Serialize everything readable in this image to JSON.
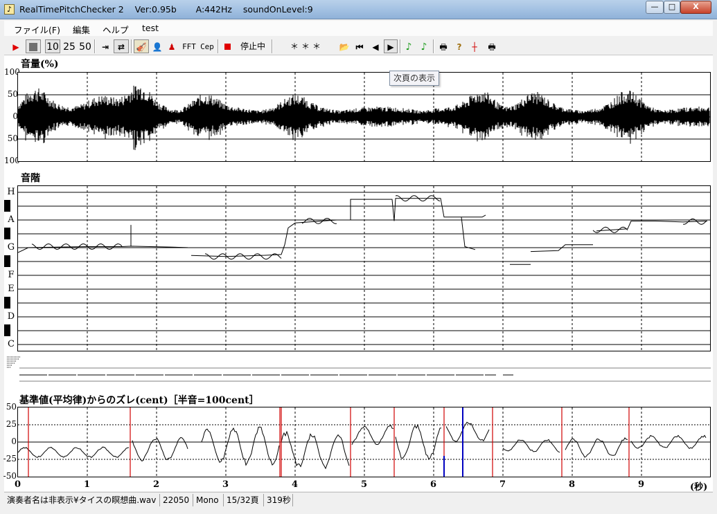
{
  "window": {
    "title": "RealTimePitchChecker 2    Ver:0.95b       A:442Hz    soundOnLevel:9",
    "minimize": "—",
    "maximize": "□",
    "close": "X"
  },
  "menu": [
    "ファイル(F)",
    "編集",
    "ヘルプ",
    "test"
  ],
  "toolbar": {
    "speed_10": "10",
    "speed_25": "25",
    "speed_50": "50",
    "fft": "FFT",
    "cep": "Cep",
    "status": "停止中",
    "stars": "＊＊＊",
    "colors": {
      "play": "#e00000",
      "stop_red": "#e00000",
      "note_green": "#1a9a1a"
    }
  },
  "tooltip": "次頁の表示",
  "volume": {
    "title": "音量(%)",
    "y_labels": [
      "100",
      "50",
      "0",
      "50",
      "100"
    ]
  },
  "scale": {
    "title": "音階",
    "notes": [
      "H",
      "A",
      "G",
      "F",
      "E",
      "D",
      "C"
    ]
  },
  "deviation": {
    "title": "基準値(平均律)からのズレ(cent)［半音=100cent］",
    "y_labels": [
      "50",
      "25",
      "0",
      "-25",
      "-50"
    ]
  },
  "time_axis": {
    "labels": [
      "0",
      "1",
      "2",
      "3",
      "4",
      "5",
      "6",
      "7",
      "8",
      "9"
    ],
    "unit": "(秒)"
  },
  "status": {
    "filename": "演奏者名は非表示¥タイスの瞑想曲.wav",
    "sample_rate": "22050",
    "channels": "Mono",
    "page": "15/32頁",
    "duration": "319秒"
  },
  "chart_data": [
    {
      "type": "area",
      "title": "音量(%)",
      "ylim": [
        -100,
        100
      ],
      "xlim": [
        0,
        10
      ],
      "y_ticks": [
        100,
        50,
        0,
        -50,
        -100
      ]
    },
    {
      "type": "line",
      "title": "音階",
      "xlim": [
        0,
        10
      ],
      "y_categories": [
        "C",
        "D",
        "E",
        "F",
        "G",
        "A",
        "H"
      ],
      "series": [
        {
          "points": [
            [
              0.0,
              4.7
            ],
            [
              0.15,
              4.95
            ],
            [
              1.0,
              5.0
            ],
            [
              1.5,
              5.0
            ],
            [
              1.63,
              5.02
            ],
            [
              2.2,
              4.98
            ],
            [
              2.45,
              4.95
            ]
          ]
        },
        {
          "points": [
            [
              2.5,
              4.55
            ],
            [
              3.0,
              4.5
            ],
            [
              3.5,
              4.55
            ],
            [
              3.8,
              4.6
            ],
            [
              3.85,
              5.1
            ],
            [
              3.9,
              5.95
            ],
            [
              4.0,
              6.2
            ],
            [
              4.6,
              6.35
            ]
          ]
        },
        {
          "points": [
            [
              4.8,
              6.35
            ],
            [
              4.8,
              7.4
            ],
            [
              5.4,
              7.4
            ],
            [
              5.43,
              6.3
            ],
            [
              5.45,
              7.45
            ],
            [
              6.1,
              7.45
            ],
            [
              6.15,
              6.5
            ],
            [
              6.7,
              6.5
            ],
            [
              6.75,
              6.6
            ]
          ]
        },
        {
          "points": [
            [
              6.4,
              6.5
            ],
            [
              6.42,
              5.9
            ],
            [
              6.45,
              5.0
            ],
            [
              6.6,
              4.85
            ]
          ]
        },
        {
          "points": [
            [
              7.1,
              4.1
            ],
            [
              7.4,
              4.1
            ]
          ]
        },
        {
          "points": [
            [
              7.4,
              4.75
            ],
            [
              7.8,
              4.8
            ],
            [
              7.9,
              5.1
            ],
            [
              8.3,
              5.1
            ]
          ]
        },
        {
          "points": [
            [
              8.35,
              5.8
            ],
            [
              8.8,
              5.9
            ],
            [
              8.85,
              6.3
            ],
            [
              9.2,
              6.3
            ],
            [
              9.6,
              6.25
            ],
            [
              9.95,
              6.3
            ]
          ]
        }
      ]
    },
    {
      "type": "line",
      "title": "基準値(平均律)からのズレ(cent)［半音=100cent］",
      "ylim": [
        -50,
        50
      ],
      "xlim": [
        0,
        10
      ],
      "y_ticks": [
        50,
        25,
        0,
        -25,
        -50
      ],
      "red_markers_x": [
        0.15,
        1.62,
        3.78,
        3.8,
        4.8,
        5.43,
        6.15,
        6.85,
        7.85,
        8.82
      ]
    }
  ]
}
